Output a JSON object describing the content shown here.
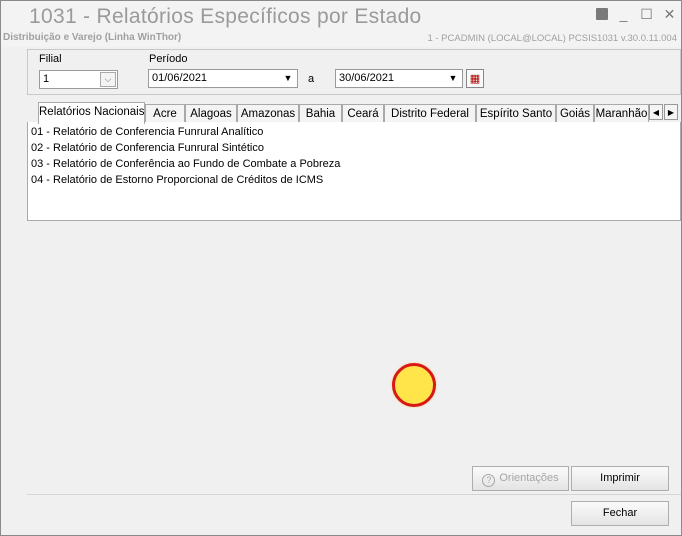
{
  "window": {
    "title": "1031 - Relatórios Específicos por Estado",
    "subtitle": "Distribuição e Varejo (Linha WinThor)",
    "info": "1 - PCADMIN (LOCAL@LOCAL)   PCSIS1031  v.30.0.11.004",
    "controls": {
      "minimize": "_",
      "maximize": "☐",
      "close": "✕"
    }
  },
  "filters": {
    "filial_label": "Filial",
    "filial_value": "1",
    "periodo_label": "Período",
    "date_start": "01/06/2021",
    "separator": "a",
    "date_end": "30/06/2021"
  },
  "tabs": [
    {
      "label": "Relatórios Nacionais",
      "active": true
    },
    {
      "label": "Acre"
    },
    {
      "label": "Alagoas"
    },
    {
      "label": "Amazonas"
    },
    {
      "label": "Bahia"
    },
    {
      "label": "Ceará"
    },
    {
      "label": "Distrito Federal"
    },
    {
      "label": "Espírito Santo"
    },
    {
      "label": "Goiás"
    },
    {
      "label": "Maranhão"
    }
  ],
  "reports": [
    "01 - Relatório de Conferencia Funrural Analítico",
    "02 - Relatório de Conferencia Funrural Sintético",
    "03 - Relatório de Conferência ao Fundo de Combate a Pobreza",
    "04 - Relatório de Estorno Proporcional de Créditos de ICMS"
  ],
  "buttons": {
    "orientacoes": "Orientações",
    "imprimir": "Imprimir",
    "fechar": "Fechar"
  },
  "icons": {
    "app": "pin-icon",
    "calendar": "calendar-icon",
    "help": "question-icon"
  }
}
